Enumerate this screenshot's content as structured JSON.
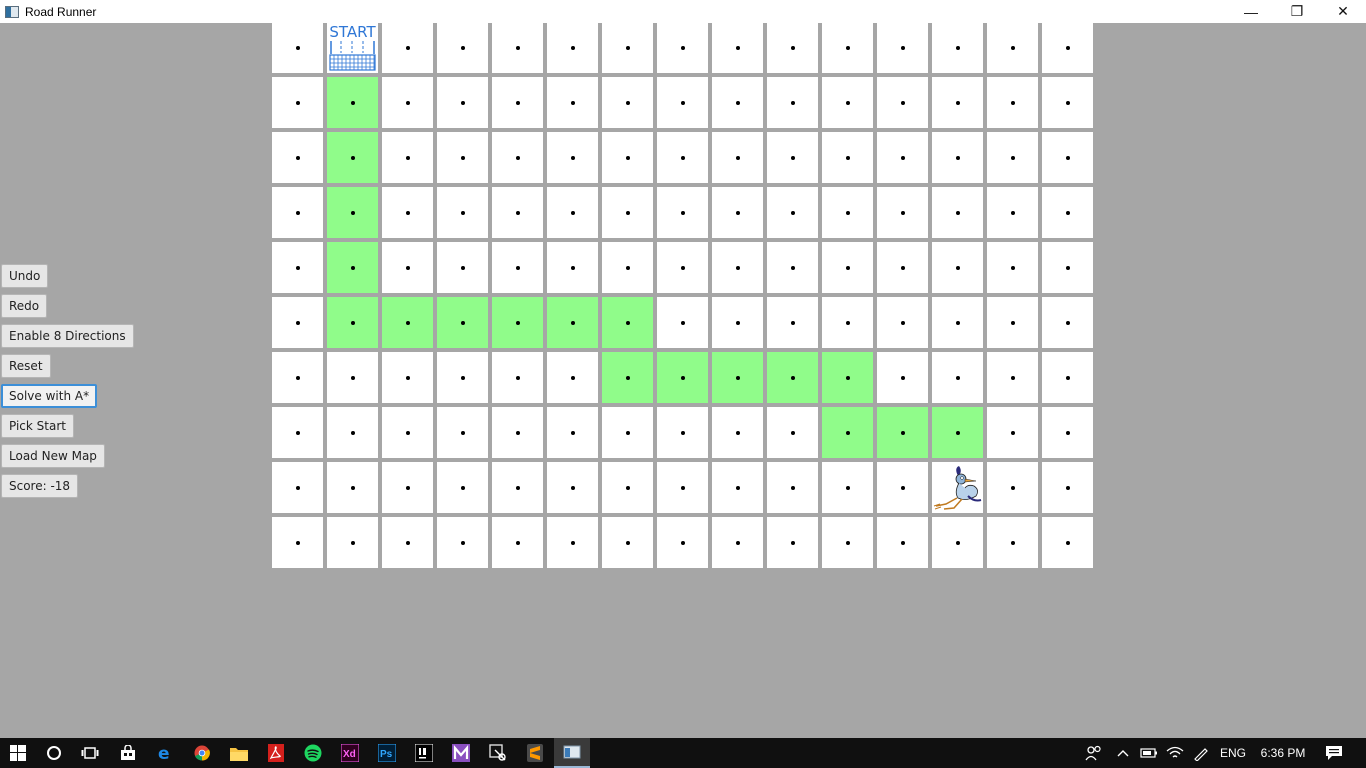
{
  "window": {
    "title": "Road Runner",
    "controls": {
      "minimize": "—",
      "restore": "❐",
      "close": "✕"
    }
  },
  "sidebar": {
    "buttons": [
      {
        "label": "Undo"
      },
      {
        "label": "Redo"
      },
      {
        "label": "Enable 8 Directions"
      },
      {
        "label": "Reset"
      },
      {
        "label": "Solve with A*",
        "focused": true
      },
      {
        "label": "Pick Start"
      },
      {
        "label": "Load New Map"
      },
      {
        "label": "Score: -18"
      }
    ]
  },
  "grid": {
    "rows": 10,
    "cols": 15,
    "start_label": "START",
    "start_cell": [
      0,
      1
    ],
    "runner_cell": [
      8,
      12
    ],
    "path_cells": [
      [
        1,
        1
      ],
      [
        2,
        1
      ],
      [
        3,
        1
      ],
      [
        4,
        1
      ],
      [
        5,
        1
      ],
      [
        5,
        2
      ],
      [
        5,
        3
      ],
      [
        5,
        4
      ],
      [
        5,
        5
      ],
      [
        5,
        6
      ],
      [
        6,
        6
      ],
      [
        6,
        7
      ],
      [
        6,
        8
      ],
      [
        6,
        9
      ],
      [
        6,
        10
      ],
      [
        7,
        10
      ],
      [
        7,
        11
      ],
      [
        7,
        12
      ]
    ],
    "colors": {
      "cell": "#ffffff",
      "path": "#90fc8a",
      "background": "#a6a6a6",
      "start": "#2f77d6"
    }
  },
  "taskbar": {
    "apps": [
      "windows-start-icon",
      "cortana-icon",
      "task-view-icon",
      "store-icon",
      "edge-icon",
      "chrome-icon",
      "file-explorer-icon",
      "acrobat-icon",
      "spotify-icon",
      "xd-icon",
      "photoshop-icon",
      "intellij-icon",
      "m-app-icon",
      "snipping-icon",
      "sublime-icon",
      "java-app-icon"
    ],
    "xd_label": "Xd",
    "ps_label": "Ps",
    "language": "ENG",
    "time": "6:36 PM"
  }
}
